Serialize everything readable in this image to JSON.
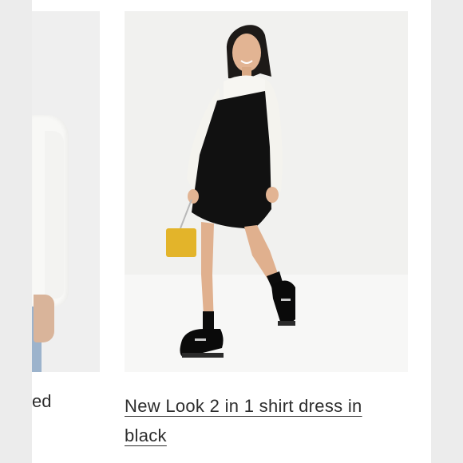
{
  "previous_product": {
    "title_fragment": "ed"
  },
  "product": {
    "title": "New Look 2 in 1 shirt dress in black"
  }
}
